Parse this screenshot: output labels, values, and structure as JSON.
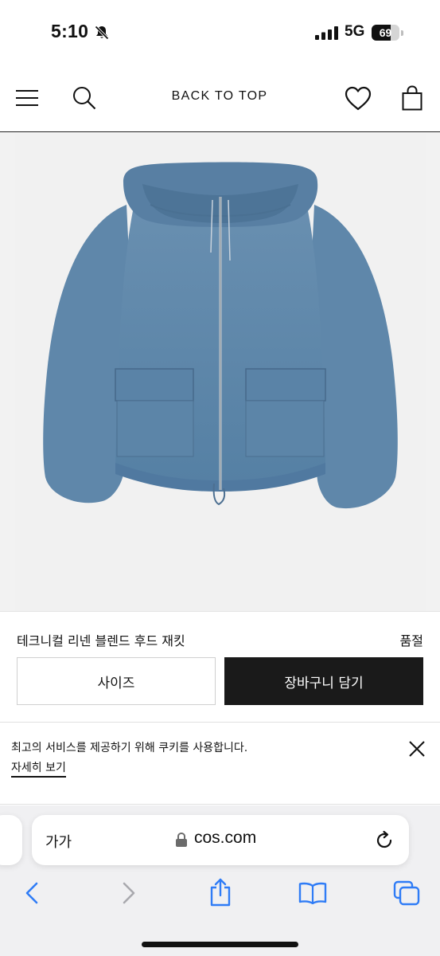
{
  "status_bar": {
    "time": "5:10",
    "network": "5G",
    "battery_level": "69",
    "battery_fraction": 0.69
  },
  "header": {
    "back_to_top": "BACK TO TOP",
    "icons": [
      "menu-icon",
      "search-icon",
      "heart-icon",
      "shopping-bag-icon"
    ]
  },
  "product": {
    "name": "테크니컬 리넨 블렌드 후드 재킷",
    "stock_status": "품절",
    "size_button_label": "사이즈",
    "add_to_bag_label": "장바구니 담기",
    "image_color": "#5f86a8"
  },
  "cookie": {
    "message": "최고의 서비스를 제공하기 위해 쿠키를 사용합니다.",
    "link_label": "자세히 보기"
  },
  "safari": {
    "text_size_label": "가가",
    "url": "cos.com"
  },
  "colors": {
    "accent_black": "#1a1a1a",
    "safari_tint": "#2f7cf6"
  }
}
